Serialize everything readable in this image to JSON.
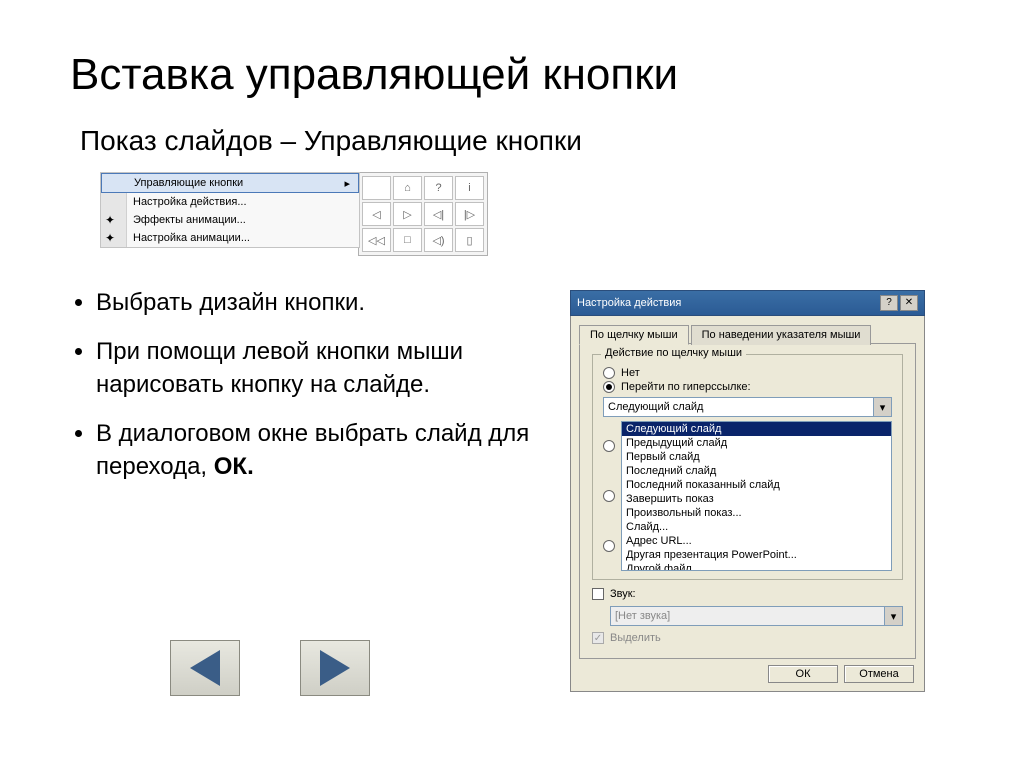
{
  "title": "Вставка управляющей кнопки",
  "subtitle": "Показ слайдов – Управляющие кнопки",
  "menu": {
    "items": [
      "Управляющие кнопки",
      "Настройка действия...",
      "Эффекты анимации...",
      "Настройка анимации..."
    ]
  },
  "bullets": {
    "b1": "Выбрать дизайн кнопки.",
    "b2": "При помощи левой кнопки мыши нарисовать кнопку на слайде.",
    "b3_pre": "В диалоговом окне выбрать слайд для перехода,  ",
    "b3_bold": "ОК."
  },
  "dialog": {
    "title": "Настройка действия",
    "tabs": {
      "t1": "По щелчку мыши",
      "t2": "По наведении указателя мыши"
    },
    "group_title": "Действие по щелчку мыши",
    "radio_none": "Нет",
    "radio_link": "Перейти по гиперссылке:",
    "combo_value": "Следующий слайд",
    "list": [
      "Следующий слайд",
      "Предыдущий слайд",
      "Первый слайд",
      "Последний слайд",
      "Последний показанный слайд",
      "Завершить показ",
      "Произвольный показ...",
      "Слайд...",
      "Адрес URL...",
      "Другая презентация PowerPoint...",
      "Другой файл..."
    ],
    "sound_label": "Звук:",
    "sound_combo": "[Нет звука]",
    "highlight_label": "Выделить",
    "ok": "ОК",
    "cancel": "Отмена"
  },
  "palette_glyphs": [
    "",
    "⌂",
    "?",
    "i",
    "◁",
    "▷",
    "◁|",
    "|▷",
    "◁◁",
    "□",
    "◁)",
    "▯"
  ]
}
